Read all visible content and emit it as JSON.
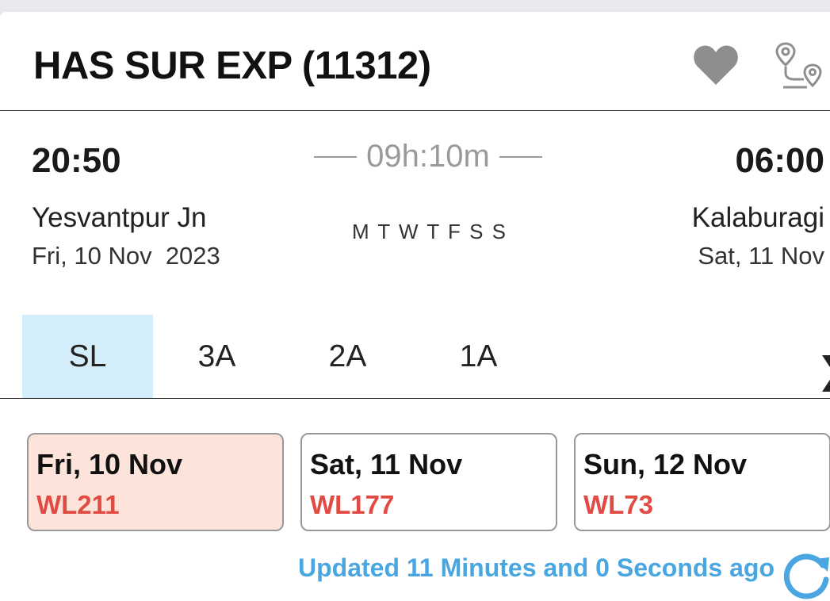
{
  "train": {
    "title": "HAS SUR EXP (11312)"
  },
  "icons": {
    "favorite": "heart-icon",
    "route": "route-map-icon",
    "refresh": "refresh-icon",
    "next": "chevron-right-icon"
  },
  "journey": {
    "departure_time": "20:50",
    "arrival_time": "06:00",
    "duration": "09h:10m",
    "from_station": "Yesvantpur Jn",
    "to_station": "Kalaburagi",
    "from_date": "Fri, 10 Nov  2023",
    "to_date": "Sat, 11 Nov",
    "run_days": "M T W T F S S"
  },
  "classes": [
    {
      "label": "SL",
      "active": true
    },
    {
      "label": "3A",
      "active": false
    },
    {
      "label": "2A",
      "active": false
    },
    {
      "label": "1A",
      "active": false
    }
  ],
  "availability": [
    {
      "date": "Fri, 10 Nov",
      "status": "WL211",
      "selected": true
    },
    {
      "date": "Sat, 11 Nov",
      "status": "WL177",
      "selected": false
    },
    {
      "date": "Sun, 12 Nov",
      "status": "WL73",
      "selected": false
    }
  ],
  "updated_text": "Updated 11 Minutes and 0 Seconds ago",
  "colors": {
    "accent_blue": "#4aa6e0",
    "waitlist_red": "#e14b44",
    "selected_class_bg": "#d3eefa",
    "selected_date_bg": "#fde4da",
    "icon_gray": "#8e8e8e"
  }
}
